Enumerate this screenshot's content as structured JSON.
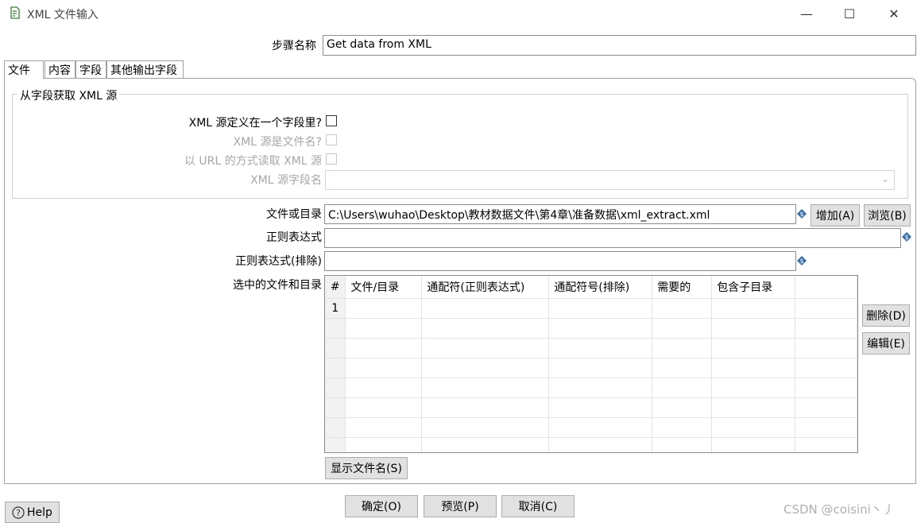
{
  "window": {
    "title": "XML 文件输入",
    "minimize_glyph": "—",
    "maximize_glyph": "☐",
    "close_glyph": "✕"
  },
  "step_name": {
    "label": "步骤名称",
    "value": "Get data from XML"
  },
  "tabs": [
    {
      "label": "文件",
      "active": true
    },
    {
      "label": "内容",
      "active": false
    },
    {
      "label": "字段",
      "active": false
    },
    {
      "label": "其他输出字段",
      "active": false
    }
  ],
  "xml_source_group": {
    "title": "从字段获取 XML 源",
    "defined_in_field": "XML 源定义在一个字段里?",
    "is_filename": "XML 源是文件名?",
    "read_as_url": "以 URL 的方式读取 XML 源",
    "source_field_name": "XML 源字段名"
  },
  "file": {
    "file_or_dir_label": "文件或目录",
    "file_or_dir_value": "C:\\Users\\wuhao\\Desktop\\教材数据文件\\第4章\\准备数据\\xml_extract.xml",
    "add_button": "增加(A)",
    "browse_button": "浏览(B)",
    "regex_label": "正则表达式",
    "regex_value": "",
    "regex_exclude_label": "正则表达式(排除)",
    "regex_exclude_value": "",
    "selected_label": "选中的文件和目录"
  },
  "grid": {
    "columns": [
      "#",
      "文件/目录",
      "通配符(正则表达式)",
      "通配符号(排除)",
      "需要的",
      "包含子目录"
    ],
    "rows": [
      [
        "1",
        "",
        "",
        "",
        "",
        ""
      ]
    ]
  },
  "side_buttons": {
    "delete": "删除(D)",
    "edit": "编辑(E)"
  },
  "show_filenames_button": "显示文件名(S)",
  "footer": {
    "help": "Help",
    "ok": "确定(O)",
    "preview": "预览(P)",
    "cancel": "取消(C)"
  },
  "watermark": "CSDN @coisini丶丿"
}
